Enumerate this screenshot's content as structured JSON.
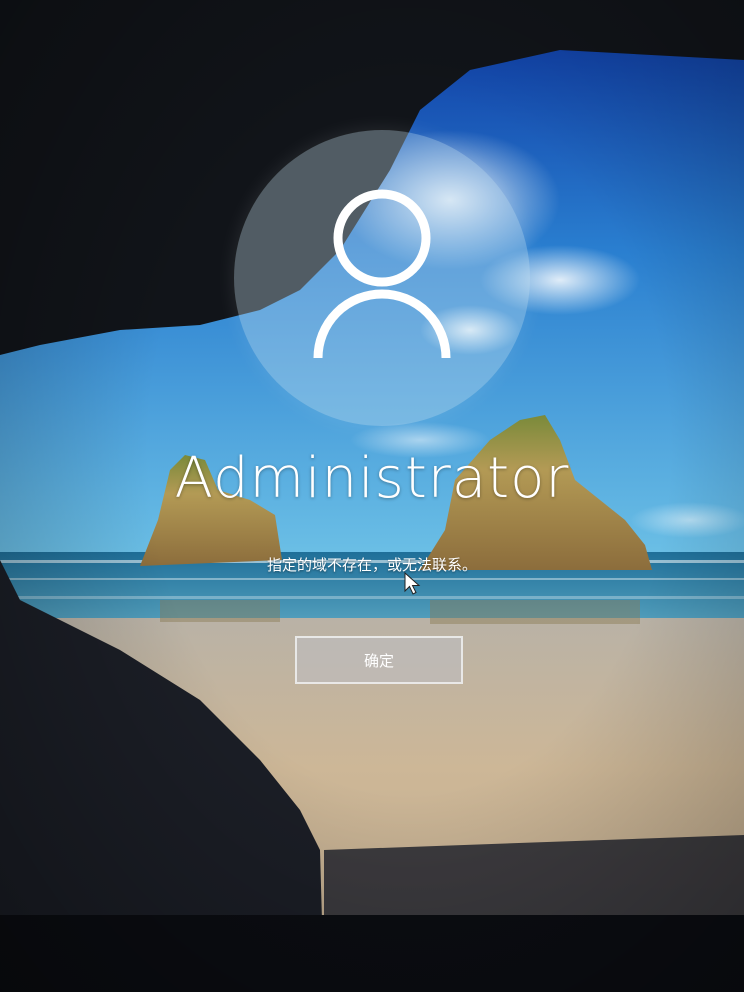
{
  "lock_screen": {
    "user_name": "Administrator",
    "error_message": "指定的域不存在，或无法联系。",
    "ok_button_label": "确定"
  },
  "icons": {
    "avatar": "user-avatar-icon",
    "cursor": "mouse-pointer-icon"
  },
  "colors": {
    "sky_top": "#0d3fa6",
    "sky_horizon": "#4aa8d8",
    "sea": "#2b7fa6",
    "sand": "#c7b193",
    "cave_rock": "#15181f"
  }
}
